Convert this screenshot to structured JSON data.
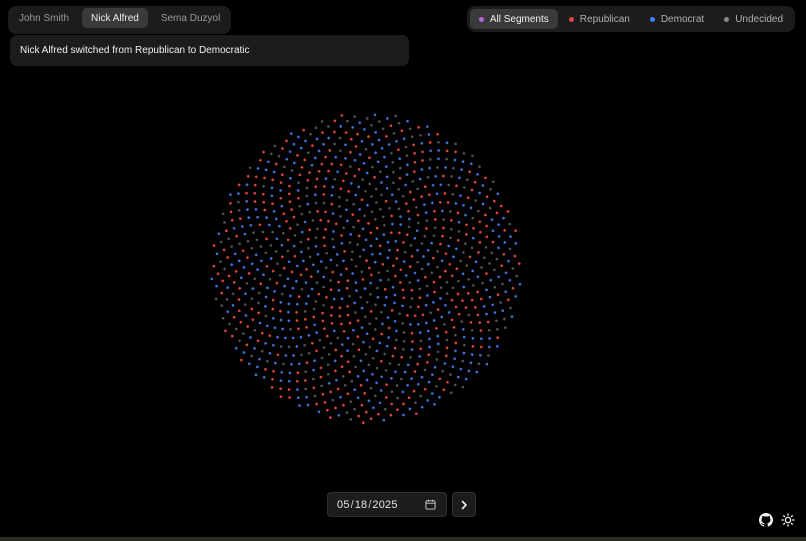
{
  "persons": {
    "items": [
      {
        "label": "John Smith",
        "active": false
      },
      {
        "label": "Nick Alfred",
        "active": true
      },
      {
        "label": "Sema Duzyol",
        "active": false
      }
    ]
  },
  "segments": {
    "items": [
      {
        "label": "All Segments",
        "color": "#b06ad9",
        "active": true
      },
      {
        "label": "Republican",
        "color": "#e0483e",
        "active": false
      },
      {
        "label": "Democrat",
        "color": "#3b82f6",
        "active": false
      },
      {
        "label": "Undecided",
        "color": "#8a8a8a",
        "active": false
      }
    ]
  },
  "notice": {
    "text": "Nick Alfred switched from Republican to Democratic"
  },
  "visualization": {
    "colors": {
      "republican": "#d9433a",
      "democrat": "#3d6fd6",
      "undecided": "#4f4f4f"
    }
  },
  "date": {
    "month": "05",
    "day": "18",
    "year": "2025",
    "separator": "/"
  },
  "icons": {
    "calendar": "calendar-icon",
    "next": "chevron-right-icon",
    "github": "github-icon",
    "theme": "sun-icon"
  }
}
